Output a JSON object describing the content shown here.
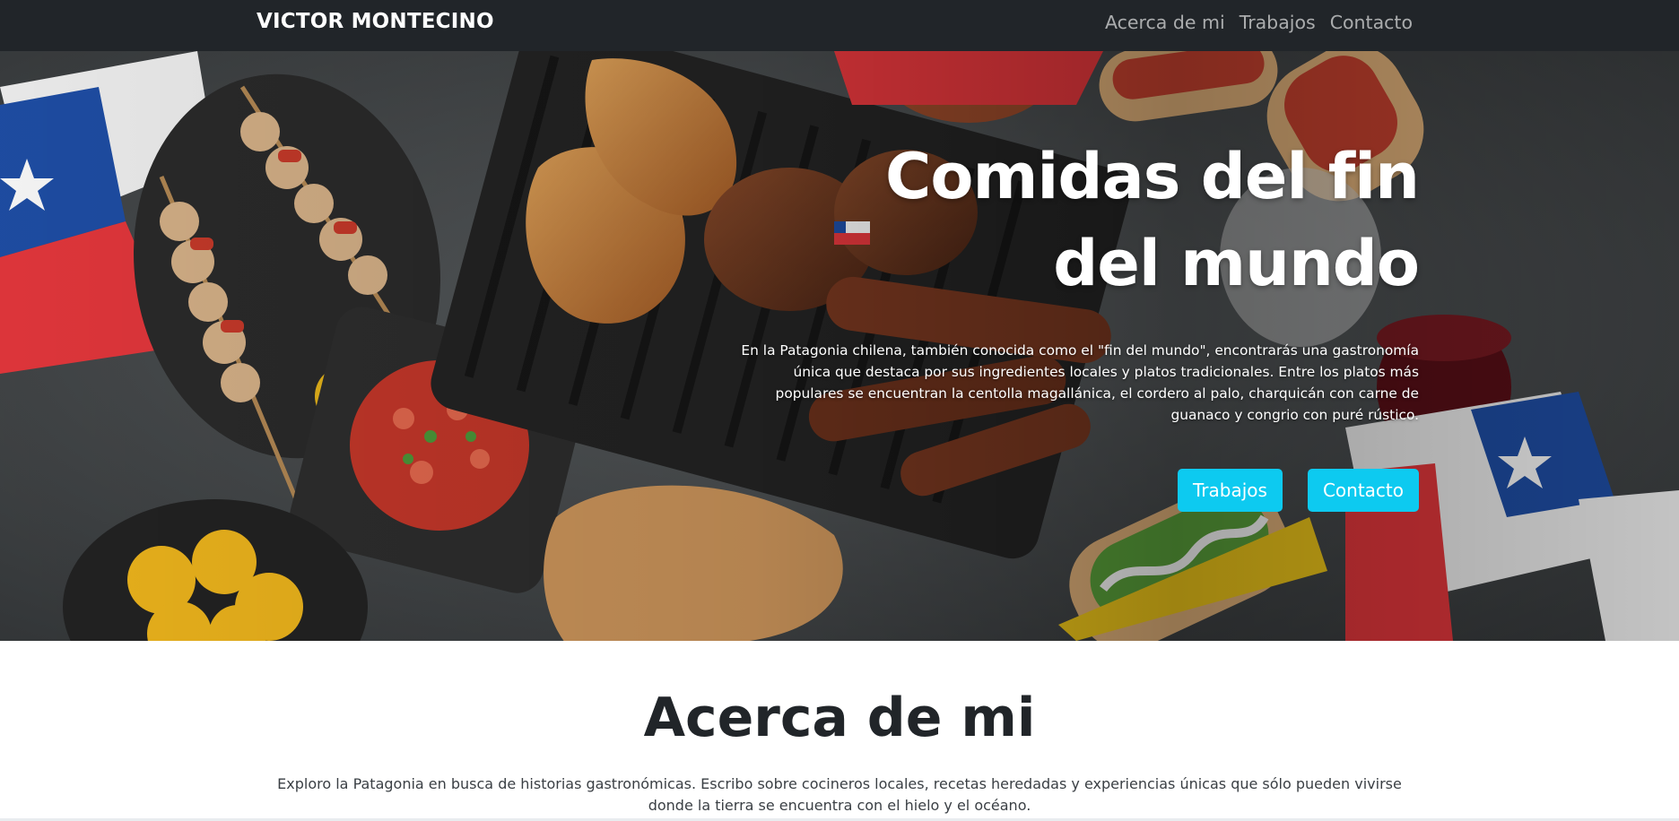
{
  "nav": {
    "brand": "VICTOR MONTECINO",
    "links": [
      "Acerca de mi",
      "Trabajos",
      "Contacto"
    ]
  },
  "hero": {
    "title_line1": "Comidas del fin",
    "title_line2": "del mundo",
    "text": "En la Patagonia chilena, también conocida como el \"fin del mundo\", encontrarás una gastronomía única que destaca por sus ingredientes locales y platos tradicionales. Entre los platos más populares se encuentran la centolla magallánica, el cordero al palo, charquicán con carne de guanaco y congrio con puré rústico.",
    "buttons": [
      "Trabajos",
      "Contacto"
    ],
    "image_icon": "chilean-barbecue-photo-illustration"
  },
  "about": {
    "title": "Acerca de mi",
    "text": "Exploro la Patagonia en busca de historias gastronómicas. Escribo sobre cocineros locales, recetas heredadas y experiencias únicas que sólo pueden vivirse donde la tierra se encuentra con el hielo y el océano."
  },
  "colors": {
    "navbar": "#212529",
    "button": "#0dcaf0",
    "flag_red": "#e8383d",
    "flag_blue": "#1f4fa8"
  }
}
